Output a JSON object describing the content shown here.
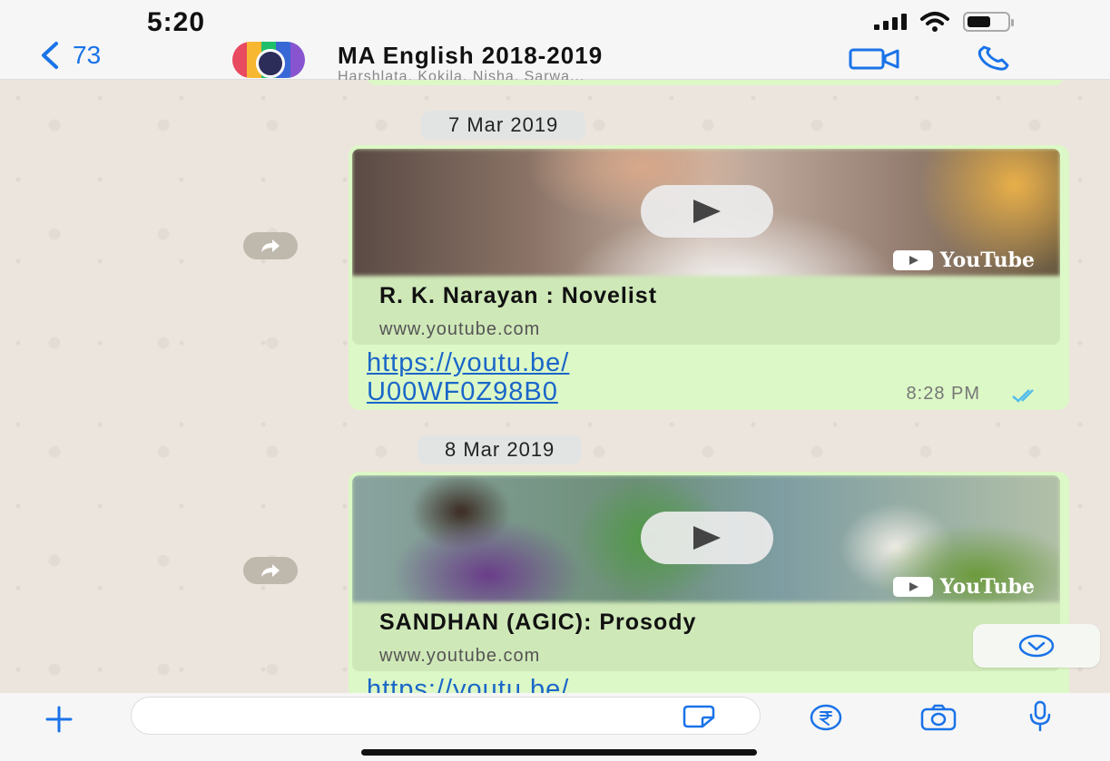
{
  "status_bar": {
    "time": "5:20",
    "battery_level": 0.6
  },
  "header": {
    "back_count": "73",
    "group_title": "MA English 2018-2019",
    "group_members": "Harshlata, Kokila, Nisha, Sarwa..."
  },
  "messages": [
    {
      "date": "7 Mar 2019",
      "link_title": "R. K. Narayan : Novelist",
      "link_domain": "www.youtube.com",
      "url_line1": "https://youtu.be/",
      "url_line2": "U00WF0Z98B0",
      "time": "8:28 PM",
      "badge": "YouTube"
    },
    {
      "date": "8 Mar 2019",
      "link_title": "SANDHAN (AGIC): Prosody",
      "link_domain": "www.youtube.com",
      "url_line1": "https://youtu.be/",
      "badge": "YouTube"
    }
  ],
  "composer": {
    "placeholder": ""
  },
  "colors": {
    "accent": "#1a73e8",
    "bubble": "#dcf8c6",
    "link": "#1a66c9",
    "chat_background": "#ece5dd"
  },
  "icons": [
    "back-chevron-icon",
    "video-call-icon",
    "phone-icon",
    "forward-icon",
    "chevron-down-icon",
    "plus-icon",
    "sticker-icon",
    "rupee-icon",
    "camera-icon",
    "microphone-icon",
    "double-check-icon"
  ]
}
